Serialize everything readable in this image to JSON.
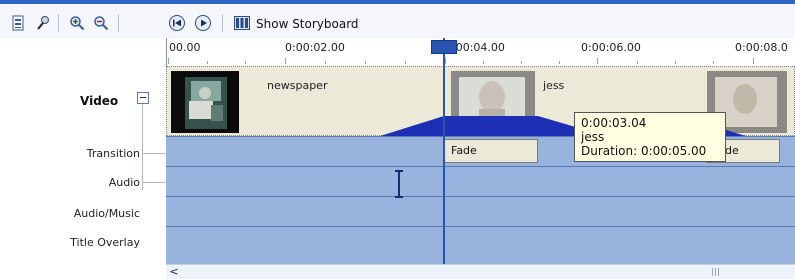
{
  "toolbar": {
    "show_storyboard_label": "Show Storyboard",
    "icons": [
      "timeline-icon",
      "narrate-icon",
      "zoom-in-icon",
      "zoom-out-icon",
      "rewind-icon",
      "play-icon",
      "storyboard-icon"
    ]
  },
  "ruler": {
    "ticks": [
      "00.00",
      "0:00:02.00",
      "0:00:04.00",
      "0:00:06.00",
      "0:00:08.0"
    ],
    "playhead_label": "0:00"
  },
  "tracks": {
    "video": "Video",
    "transition": "Transition",
    "audio": "Audio",
    "audio_music": "Audio/Music",
    "title_overlay": "Title Overlay"
  },
  "clips": [
    {
      "name": "newspaper"
    },
    {
      "name": "jess"
    }
  ],
  "transitions": [
    "Fade",
    "Fade"
  ],
  "tooltip": {
    "time": "0:00:03.04",
    "clip": "jess",
    "duration": "Duration:  0:00:05.00"
  },
  "scrollbar": {
    "left_arrow": "<"
  },
  "colors": {
    "track_blue": "#98b3de",
    "transition_blue": "#1c2fb5",
    "tooltip_bg": "#ffffe1",
    "playhead": "#2a55b0"
  }
}
